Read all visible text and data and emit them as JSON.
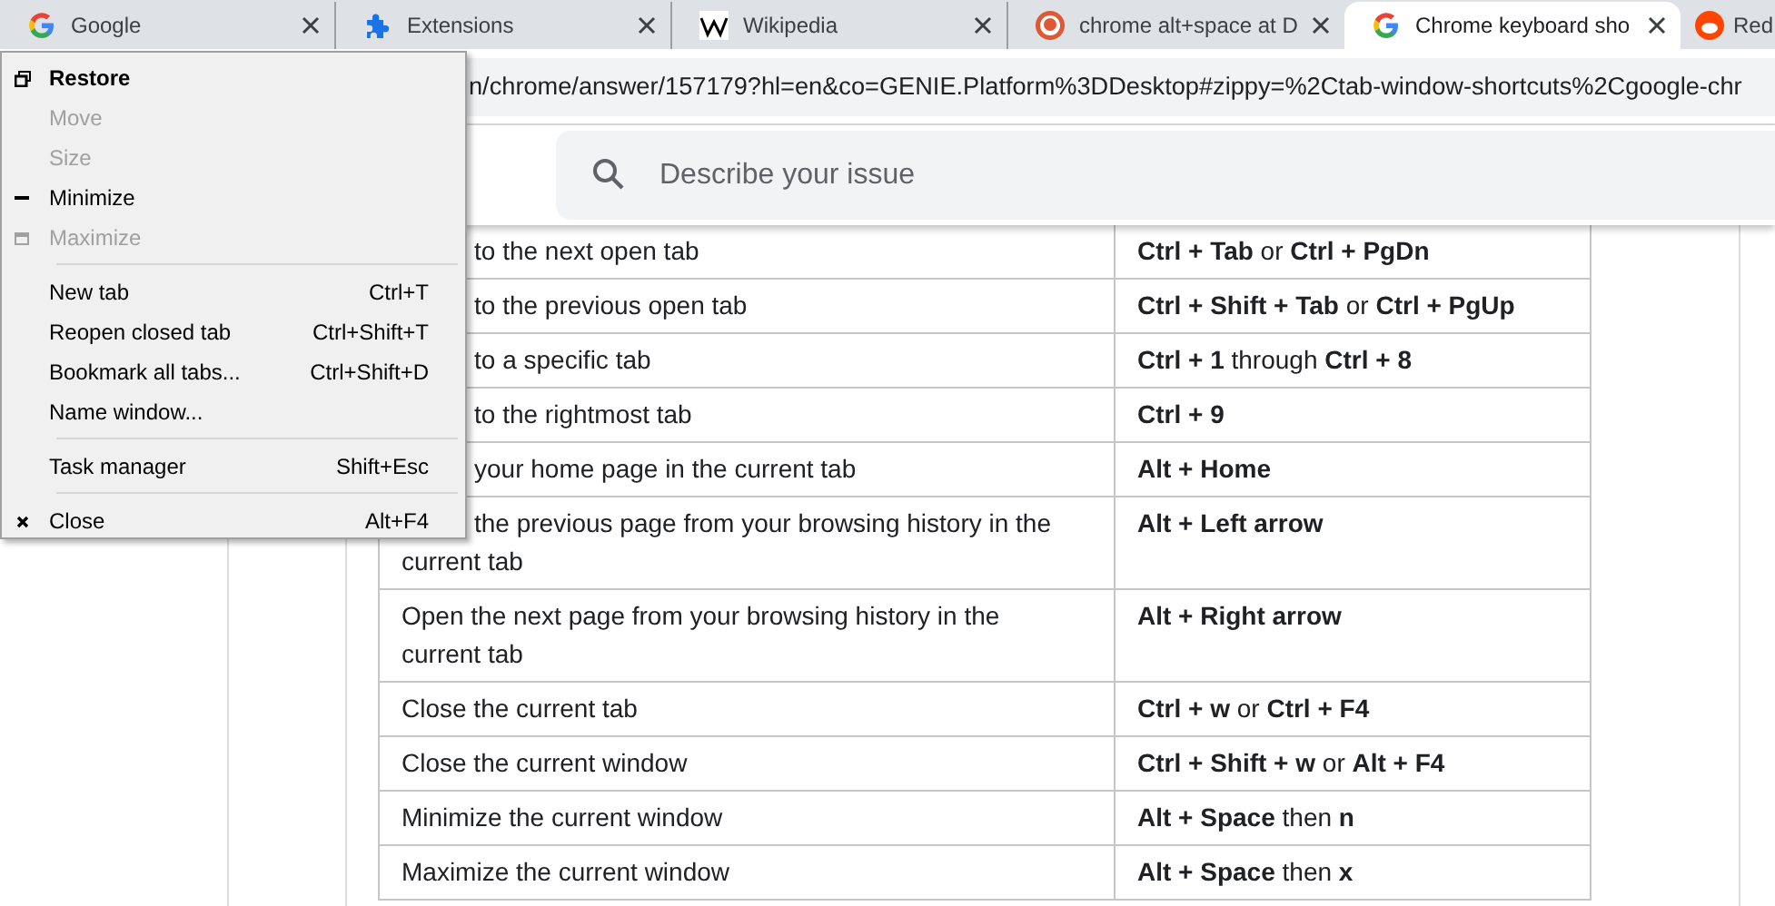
{
  "tabs": [
    {
      "title": "Google",
      "selected": false
    },
    {
      "title": "Extensions",
      "selected": false
    },
    {
      "title": "Wikipedia",
      "selected": false
    },
    {
      "title": "chrome alt+space at D",
      "selected": false
    },
    {
      "title": "Chrome keyboard sho",
      "selected": true
    },
    {
      "title": "Red",
      "selected": false
    }
  ],
  "address_bar": {
    "url": "n/chrome/answer/157179?hl=en&co=GENIE.Platform%3DDesktop#zippy=%2Ctab-window-shortcuts%2Cgoogle-chr"
  },
  "search": {
    "placeholder": "Describe your issue"
  },
  "shortcuts_table": {
    "rows": [
      {
        "action": "to the next open tab",
        "keys": "**Ctrl + Tab** or **Ctrl + PgDn**",
        "partial": true
      },
      {
        "action": "to the previous open tab",
        "keys": "**Ctrl + Shift + Tab** or **Ctrl + PgUp**",
        "partial": true
      },
      {
        "action": "to a specific tab",
        "keys": "**Ctrl + 1** through **Ctrl + 8**",
        "partial": true
      },
      {
        "action": "to the rightmost tab",
        "keys": "**Ctrl + 9**",
        "partial": true
      },
      {
        "action": "your home page in the current tab",
        "keys": "**Alt + Home**",
        "partial": true
      },
      {
        "action": "the previous page from your browsing history in the current tab",
        "keys": "**Alt + Left arrow**",
        "partial": true
      },
      {
        "action": "Open the next page from your browsing history in the current tab",
        "keys": "**Alt + Right arrow**",
        "partial": false
      },
      {
        "action": "Close the current tab",
        "keys": "**Ctrl + w** or **Ctrl + F4**",
        "partial": false
      },
      {
        "action": "Close the current window",
        "keys": "**Ctrl + Shift + w** or **Alt + F4**",
        "partial": false
      },
      {
        "action": "Minimize the current window",
        "keys": "**Alt + Space** then **n**",
        "partial": false
      },
      {
        "action": "Maximize the current window",
        "keys": "**Alt + Space** then **x**",
        "partial": false
      }
    ]
  },
  "system_menu": {
    "items": [
      {
        "kind": "item",
        "label": "Restore",
        "default": true,
        "disabled": false
      },
      {
        "kind": "item",
        "label": "Move",
        "default": false,
        "disabled": true
      },
      {
        "kind": "item",
        "label": "Size",
        "default": false,
        "disabled": true
      },
      {
        "kind": "item",
        "label": "Minimize",
        "default": false,
        "disabled": false
      },
      {
        "kind": "item",
        "label": "Maximize",
        "default": false,
        "disabled": true
      },
      {
        "kind": "separator"
      },
      {
        "kind": "item",
        "label": "New tab",
        "shortcut": "Ctrl+T",
        "default": false,
        "disabled": false
      },
      {
        "kind": "item",
        "label": "Reopen closed tab",
        "shortcut": "Ctrl+Shift+T",
        "default": false,
        "disabled": false
      },
      {
        "kind": "item",
        "label": "Bookmark all tabs...",
        "shortcut": "Ctrl+Shift+D",
        "default": false,
        "disabled": false
      },
      {
        "kind": "item",
        "label": "Name window...",
        "default": false,
        "disabled": false
      },
      {
        "kind": "separator"
      },
      {
        "kind": "item",
        "label": "Task manager",
        "shortcut": "Shift+Esc",
        "default": false,
        "disabled": false
      },
      {
        "kind": "separator"
      },
      {
        "kind": "item",
        "label": "Close",
        "shortcut": "Alt+F4",
        "default": false,
        "disabled": false
      }
    ]
  }
}
